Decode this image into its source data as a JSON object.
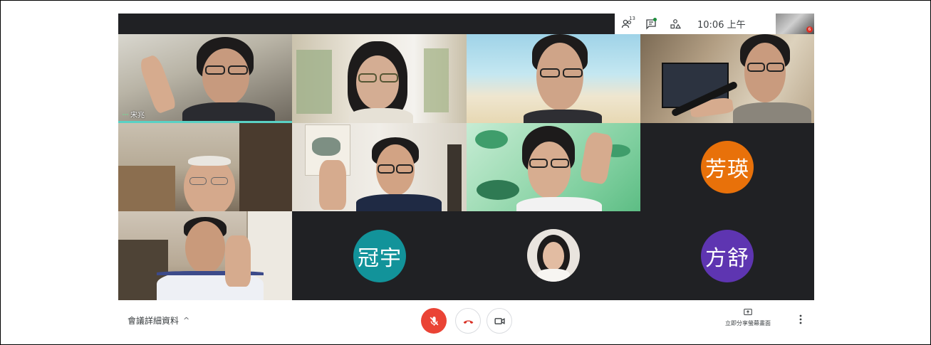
{
  "top_bar": {
    "participants_count": "13",
    "clock": "10:06 上午",
    "self_badge": "6"
  },
  "tiles": {
    "t1_name": "宋兆",
    "fangying": {
      "label": "芳瑛",
      "color": "#e8710a"
    },
    "guanyu": {
      "label": "冠宇",
      "color": "#12939a"
    },
    "fangshu": {
      "label": "方舒",
      "color": "#5e35b1"
    }
  },
  "bottom_bar": {
    "meeting_details": "會議詳細資料",
    "present_now": "立即分享螢幕畫面"
  },
  "colors": {
    "mic_off": "#ea4335",
    "hangup": "#d93025",
    "speaking": "#5ad1c4"
  }
}
